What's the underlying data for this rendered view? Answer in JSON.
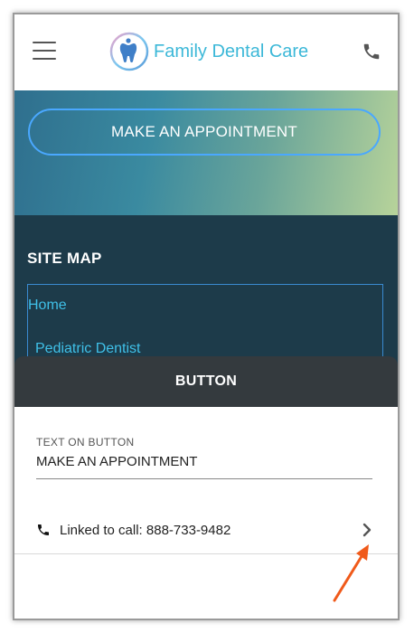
{
  "header": {
    "brand_name": "Family Dental Care"
  },
  "hero": {
    "appointment_button_label": "MAKE AN APPOINTMENT"
  },
  "sitemap": {
    "title": "SITE MAP",
    "links": [
      "Home",
      "Pediatric Dentist"
    ]
  },
  "sheet": {
    "title": "BUTTON",
    "text_field_label": "TEXT ON BUTTON",
    "text_field_value": "MAKE AN APPOINTMENT",
    "link_label": "Linked to call: 888-733-9482"
  },
  "colors": {
    "brand_blue": "#3cb8d8",
    "sitemap_bg": "#1d3b4a",
    "sheet_header_bg": "#343a3e",
    "arrow": "#f05a1a"
  }
}
